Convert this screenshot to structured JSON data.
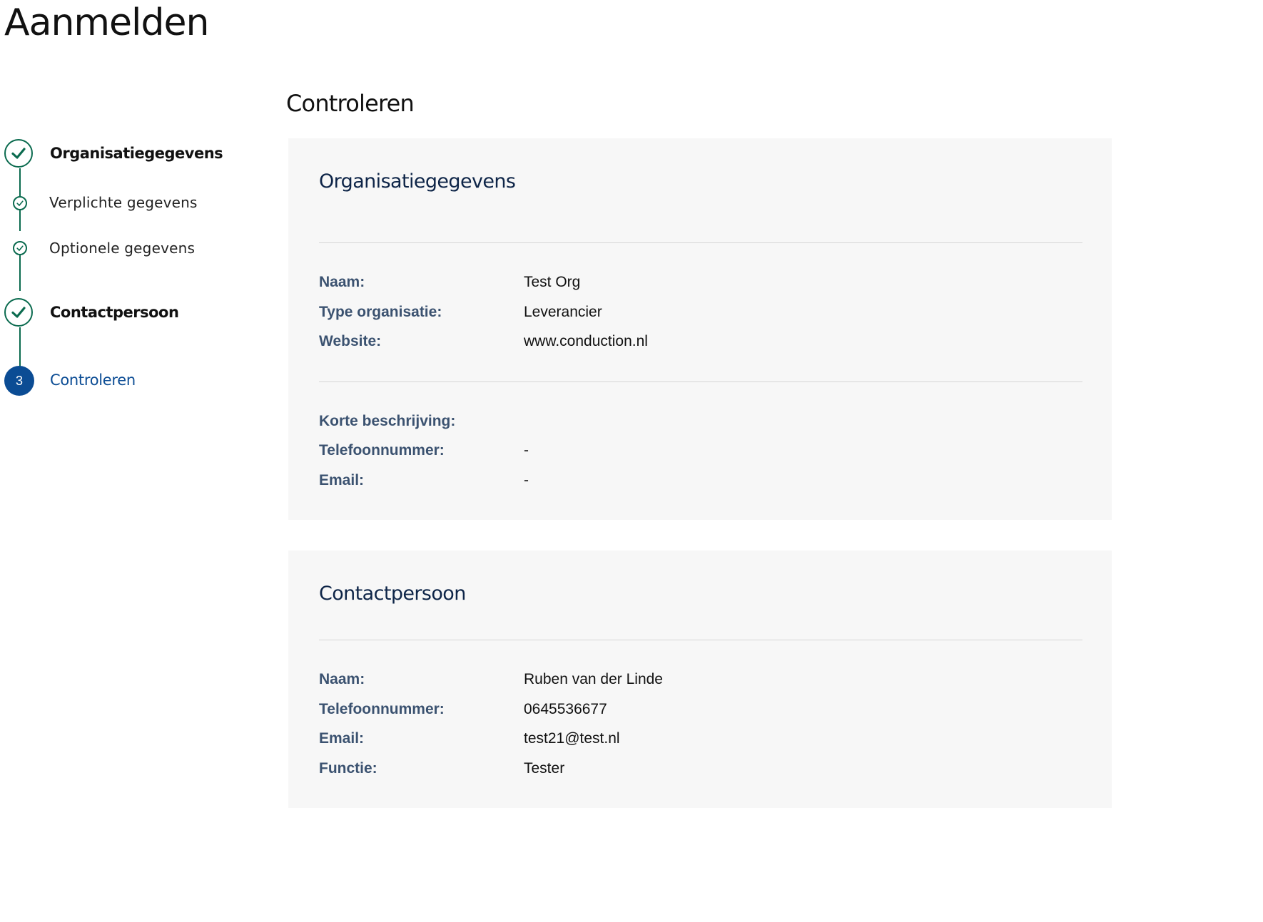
{
  "page": {
    "title": "Aanmelden"
  },
  "stepper": {
    "steps": [
      {
        "label": "Organisatiegegevens",
        "state": "completed"
      },
      {
        "label": "Verplichte gegevens",
        "state": "completed"
      },
      {
        "label": "Optionele gegevens",
        "state": "completed"
      },
      {
        "label": "Contactpersoon",
        "state": "completed"
      },
      {
        "number": "3",
        "label": "Controleren",
        "state": "active"
      }
    ],
    "colors": {
      "completed": "#0b6b4f",
      "active": "#0b4c94"
    }
  },
  "main": {
    "title": "Controleren",
    "organisation": {
      "title": "Organisatiegegevens",
      "rows": [
        {
          "label": "Naam:",
          "value": "Test Org"
        },
        {
          "label": "Type organisatie:",
          "value": "Leverancier"
        },
        {
          "label": "Website:",
          "value": "www.conduction.nl"
        }
      ],
      "rows2": [
        {
          "label": "Korte beschrijving:",
          "value": ""
        },
        {
          "label": "Telefoonnummer:",
          "value": "-"
        },
        {
          "label": "Email:",
          "value": "-"
        }
      ]
    },
    "contact": {
      "title": "Contactpersoon",
      "rows": [
        {
          "label": "Naam:",
          "value": "Ruben van der Linde"
        },
        {
          "label": "Telefoonnummer:",
          "value": "0645536677"
        },
        {
          "label": "Email:",
          "value": "test21@test.nl"
        },
        {
          "label": "Functie:",
          "value": "Tester"
        }
      ]
    }
  },
  "icons": {
    "completed_step": "check-circle-icon"
  }
}
